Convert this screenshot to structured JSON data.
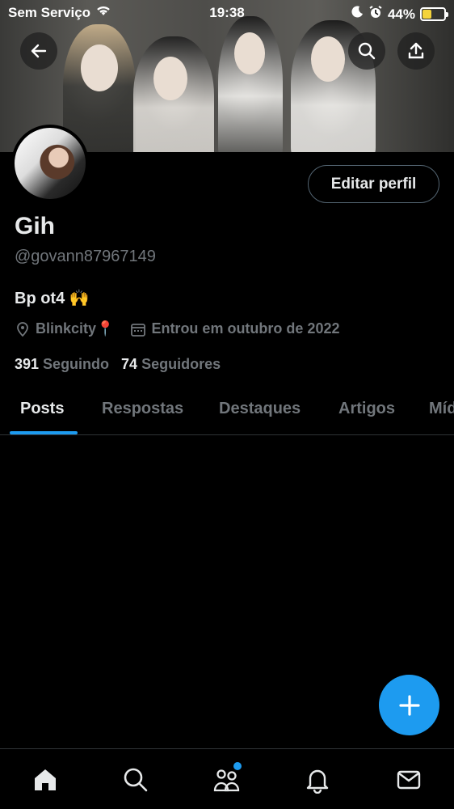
{
  "status_bar": {
    "carrier": "Sem Serviço",
    "time": "19:38",
    "battery_percent_label": "44%",
    "battery_level": 0.44,
    "battery_color": "#f4d33b"
  },
  "profile": {
    "name": "Gih",
    "handle": "@govann87967149",
    "bio": "Bp ot4 🙌",
    "location": "Blinkcity📍",
    "joined": "Entrou em outubro de 2022",
    "following_count": "391",
    "following_label": "Seguindo",
    "followers_count": "74",
    "followers_label": "Seguidores",
    "edit_button": "Editar perfil"
  },
  "tabs": [
    {
      "label": "Posts",
      "active": true
    },
    {
      "label": "Respostas",
      "active": false
    },
    {
      "label": "Destaques",
      "active": false
    },
    {
      "label": "Artigos",
      "active": false
    },
    {
      "label": "Mídia",
      "active": false
    }
  ],
  "colors": {
    "accent": "#1d9bf0",
    "background": "#000000",
    "text_primary": "#e7e9ea",
    "text_secondary": "#71767b",
    "border": "#2f3336"
  },
  "icons": {
    "back": "arrow-left-icon",
    "search": "search-icon",
    "share": "share-icon",
    "location": "location-pin-icon",
    "calendar": "calendar-icon",
    "compose": "plus-icon",
    "nav": [
      "home-icon",
      "search-icon",
      "communities-icon",
      "bell-icon",
      "mail-icon"
    ]
  }
}
